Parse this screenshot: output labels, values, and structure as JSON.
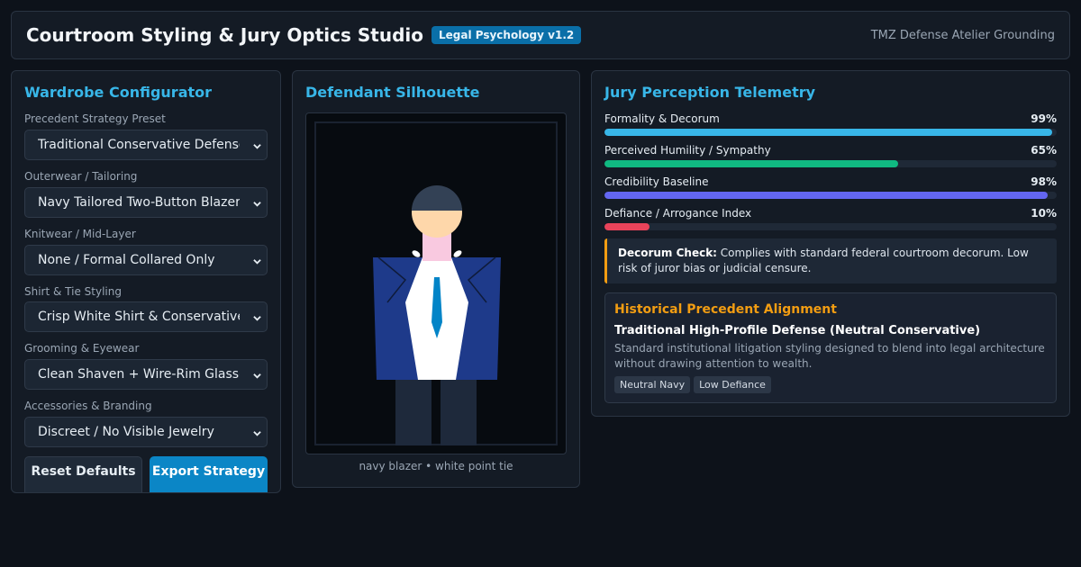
{
  "header": {
    "title": "Courtroom Styling & Jury Optics Studio",
    "badge": "Legal Psychology v1.2",
    "right_text": "TMZ Defense Atelier Grounding"
  },
  "wardrobe": {
    "title": "Wardrobe Configurator",
    "fields": [
      {
        "label": "Precedent Strategy Preset",
        "value": "Traditional Conservative Defense"
      },
      {
        "label": "Outerwear / Tailoring",
        "value": "Navy Tailored Two-Button Blazer"
      },
      {
        "label": "Knitwear / Mid-Layer",
        "value": "None / Formal Collared Only"
      },
      {
        "label": "Shirt & Tie Styling",
        "value": "Crisp White Shirt & Conservative Tie"
      },
      {
        "label": "Grooming & Eyewear",
        "value": "Clean Shaven + Wire-Rim Glasses"
      },
      {
        "label": "Accessories & Branding",
        "value": "Discreet / No Visible Jewelry"
      }
    ],
    "reset_label": "Reset Defaults",
    "export_label": "Export Strategy"
  },
  "silhouette": {
    "title": "Defendant Silhouette",
    "caption": "navy blazer • white point tie"
  },
  "telemetry": {
    "title": "Jury Perception Telemetry",
    "metrics": [
      {
        "label": "Formality & Decorum",
        "pct_text": "99%",
        "value": 0.99,
        "color": "#38b6e8"
      },
      {
        "label": "Perceived Humility / Sympathy",
        "pct_text": "65%",
        "value": 0.65,
        "color": "#10b981"
      },
      {
        "label": "Credibility Baseline",
        "pct_text": "98%",
        "value": 0.98,
        "color": "#6366f1"
      },
      {
        "label": "Defiance / Arrogance Index",
        "pct_text": "10%",
        "value": 0.1,
        "color": "#e8435a"
      }
    ],
    "decorum_label": "Decorum Check:",
    "decorum_text": " Complies with standard federal courtroom decorum. Low risk of juror bias or judicial censure.",
    "precedent": {
      "title": "Historical Precedent Alignment",
      "subtitle": "Traditional High-Profile Defense (Neutral Conservative)",
      "description": "Standard institutional litigation styling designed to blend into legal architecture without drawing attention to wealth.",
      "tags": [
        "Neutral Navy",
        "Low Defiance"
      ]
    }
  },
  "colors": {
    "accent": "#38b6e8",
    "warning": "#f29d12",
    "blazer": "#1e3a8a",
    "tie": "#0284c7"
  }
}
